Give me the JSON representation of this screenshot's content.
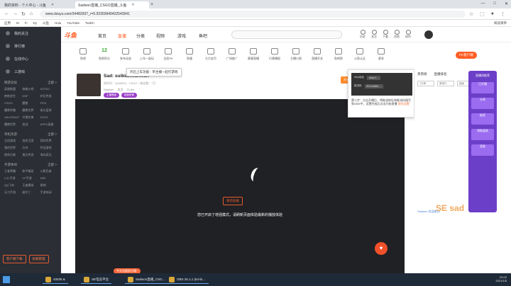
{
  "tabs": [
    {
      "label": "我的资料 - 个人中心 - 斗鱼",
      "active": false
    },
    {
      "label": "Sadwon直播_CSGO直播_斗鱼",
      "active": true
    }
  ],
  "window_controls": [
    "—",
    "□",
    "✕"
  ],
  "address": {
    "url": "www.douyu.com/34483937_r=0.92359949422543941",
    "back": "←",
    "forward": "→",
    "reload": "↻",
    "home": "⌂"
  },
  "bookmarks": {
    "items": [
      "应用",
      "M",
      "Fi",
      "Dy",
      "斗鱼",
      "Hulu",
      "YouTube",
      "Twitch"
    ],
    "right": "阅读清单"
  },
  "sidebar": {
    "items": [
      "我的关注",
      "排行榜",
      "在线中心",
      "三游戏"
    ],
    "sec1": {
      "title": "网游竞技",
      "more": "全部 >",
      "grid": [
        "英雄联盟",
        "穿越火线",
        "DOTA2",
        "绝地求生",
        "DNF",
        "炉石传说",
        "CSGO",
        "魔兽",
        "FIFA",
        "魔兽争霸",
        "魔兽世界",
        "街头篮球",
        "VALORANT",
        "守望先锋",
        "DOTA",
        "魔兽世界",
        "逆战",
        "APEX英雄"
      ]
    },
    "sec2": {
      "title": "单机热游",
      "more": "全部 >",
      "grid": [
        "主机游戏",
        "洛克王国",
        "我的世界",
        "我的世界",
        "方舟",
        "怀旧游戏",
        "使命召唤",
        "鬼泣传说",
        "海岛奇兵"
      ]
    },
    "sec3": {
      "title": "手游休闲",
      "more": "全部 >",
      "grid": [
        "王者荣耀",
        "和平精英",
        "火影忍者",
        "LOL手游",
        "CF手游",
        "DNF",
        "QQ飞车",
        "王者模拟",
        "原神",
        "天刀手游",
        "崩坏三",
        "手游休闲"
      ]
    },
    "buttons": [
      "客户端下载",
      "投稿管理"
    ]
  },
  "topnav": {
    "logo": "斗鱼",
    "links": [
      "首页",
      "直播",
      "分类",
      "视频",
      "游戏",
      "鱼吧"
    ],
    "icons": [
      "历史",
      "关注",
      "下载",
      "消息",
      "创作"
    ]
  },
  "categories": [
    {
      "label": "鱼吧",
      "num": ""
    },
    {
      "label": "鱼吧积分",
      "num": "12"
    },
    {
      "label": "发布动态",
      "num": ""
    },
    {
      "label": "上车一起玩",
      "num": ""
    },
    {
      "label": "全民PK",
      "num": ""
    },
    {
      "label": "鱼塘",
      "num": ""
    },
    {
      "label": "大力金币",
      "num": ""
    },
    {
      "label": "广场推广",
      "num": ""
    },
    {
      "label": "赛事直播",
      "num": ""
    },
    {
      "label": "行情播报",
      "num": ""
    },
    {
      "label": "主播口袋",
      "num": ""
    },
    {
      "label": "直播开关",
      "num": ""
    },
    {
      "label": "鱼吧帮",
      "num": ""
    },
    {
      "label": "斗鱼认证",
      "num": ""
    },
    {
      "label": "更多",
      "num": ""
    }
  ],
  "pc_button": "PC客户端",
  "tooltip": "开启上车功能：带主播一起打游戏",
  "room": {
    "title": "Sad: suibianwanwan",
    "sub": "房间号：3448393，CSGO｜粉丝数：7万",
    "meta": [
      "Sadwon",
      "关注",
      "21.6w"
    ],
    "tags": [
      "主播等级",
      "超级房管"
    ],
    "follow_popup": "开启提醒"
  },
  "player": {
    "play_label": "重新加载",
    "message": "您已开启了增强模式，请刷新页面体验最新的播放体验"
  },
  "popover": {
    "row1_label": "rtmp地址",
    "row1_value": "rtmp://…",
    "row2_label": "推流码",
    "row2_value": "9C1C4884…",
    "text": "第二步：点击开播后，将推流地址和推流码填写到OBS中，设置完成后点击开始直播",
    "link": "前往设置"
  },
  "rpanel": {
    "tabs": [
      "贵宾榜",
      "直播排名"
    ],
    "boxes": [
      "7日榜",
      "周排行",
      "超级"
    ],
    "chat": "Sadwon 欢迎来到",
    "logo": "SE sad"
  },
  "banner": {
    "top": "直播间推荐",
    "items": [
      "已开播",
      "分享",
      "抽奖",
      "领取道具",
      "奖励"
    ]
  },
  "promo": "今天也要努力哦~",
  "taskbar": {
    "apps": [
      "40035 &",
      "SE电竞平台",
      "Sadwon直播_CSG…",
      "OBS 26.1.1 (64-bi…"
    ],
    "time": "22:02",
    "date": "2021/1/5"
  }
}
